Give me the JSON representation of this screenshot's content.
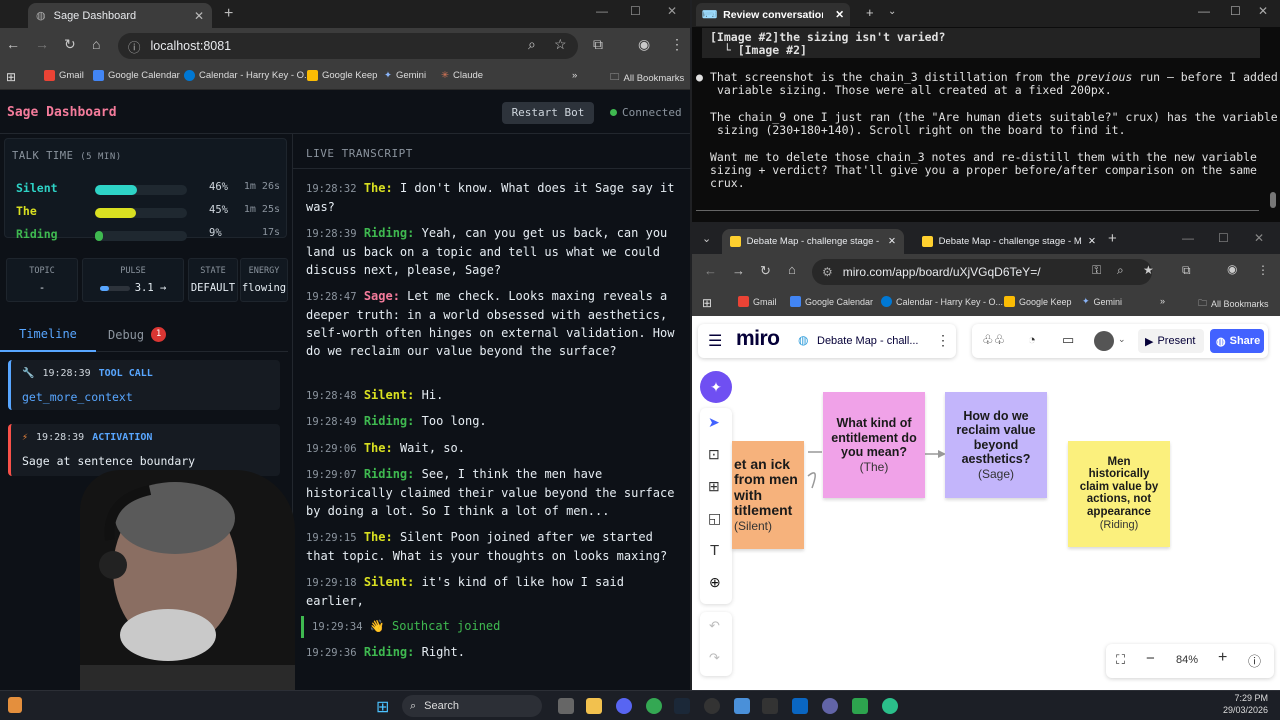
{
  "left_browser": {
    "tab_title": "Sage Dashboard",
    "url": "localhost:8081",
    "bookmarks": [
      "Gmail",
      "Google Calendar",
      "Calendar - Harry Key - O...",
      "Google Keep",
      "Gemini",
      "Claude"
    ],
    "all_bookmarks": "All Bookmarks"
  },
  "dashboard": {
    "title": "Sage Dashboard",
    "restart_label": "Restart Bot",
    "status": "Connected",
    "talk_time": {
      "heading": "TALK TIME",
      "window": "(5 MIN)",
      "rows": [
        {
          "name": "Silent",
          "pct": "46%",
          "fraction": 0.46,
          "time": "1m 26s",
          "color": "#2ed3c6"
        },
        {
          "name": "The",
          "pct": "45%",
          "fraction": 0.45,
          "time": "1m 25s",
          "color": "#d9e021"
        },
        {
          "name": "Riding",
          "pct": "9%",
          "fraction": 0.09,
          "time": "17s",
          "color": "#3fb950"
        }
      ]
    },
    "stats": {
      "topic_label": "TOPIC",
      "topic_value": "-",
      "pulse_label": "PULSE",
      "pulse_value": "3.1 →",
      "pulse_level": 0.31,
      "state_label": "STATE",
      "state_value": "DEFAULT",
      "energy_label": "ENERGY",
      "energy_value": "flowing"
    },
    "tabs": {
      "timeline": "Timeline",
      "debug": "Debug",
      "debug_count": "1"
    },
    "events": [
      {
        "time": "19:28:39",
        "type": "TOOL CALL",
        "text": "get_more_context",
        "color": "#58a6ff"
      },
      {
        "time": "19:28:39",
        "type": "ACTIVATION",
        "text": "Sage at sentence boundary",
        "color": "#f85149"
      }
    ],
    "transcript_heading": "LIVE TRANSCRIPT",
    "transcript": [
      {
        "time": "19:28:32",
        "speaker": "The:",
        "text": "I don't know. What does it Sage say it was?"
      },
      {
        "time": "19:28:39",
        "speaker": "Riding:",
        "text": "Yeah, can you get us back, can you land us back on a topic and tell us what we could discuss next, please, Sage?"
      },
      {
        "time": "19:28:47",
        "speaker": "Sage:",
        "text": "Let me check. Looks maxing reveals a deeper truth: in a world obsessed with aesthetics, self-worth often hinges on external validation. How do we reclaim our value beyond the surface?"
      },
      {
        "time": "19:28:48",
        "speaker": "Silent:",
        "text": "Hi."
      },
      {
        "time": "19:28:49",
        "speaker": "Riding:",
        "text": "Too long."
      },
      {
        "time": "19:29:06",
        "speaker": "The:",
        "text": "Wait, so."
      },
      {
        "time": "19:29:07",
        "speaker": "Riding:",
        "text": "See, I think the men have historically claimed their value beyond the surface by doing a lot. So I think a lot of men..."
      },
      {
        "time": "19:29:15",
        "speaker": "The:",
        "text": "Silent Poon joined after we started that topic. What is your thoughts on looks maxing?"
      },
      {
        "time": "19:29:18",
        "speaker": "Silent:",
        "text": "it's kind of like how I said earlier,"
      },
      {
        "time": "19:29:34",
        "speaker": "👋",
        "text": "Southcat joined"
      },
      {
        "time": "19:29:36",
        "speaker": "Riding:",
        "text": "Right."
      }
    ]
  },
  "terminal": {
    "tab_title": "Review conversation a",
    "line1": "[Image #2]the sizing isn't varied?",
    "line2": "  └ [Image #2]",
    "line3": "That screenshot is the chain_3 distillation from the ",
    "line3_em": "previous",
    "line3_end": " run — before I added",
    "line4": "variable sizing. Those were all created at a fixed 200px.",
    "line5": "The chain_9 one I just ran (the \"Are human diets suitable?\" crux) has the variable",
    "line6": "sizing (230+180+140). Scroll right on the board to find it.",
    "line7": "Want me to delete those chain_3 notes and re-distill them with the new variable",
    "line8": "sizing + verdict? That'll give you a proper before/after comparison on the same",
    "line9": "crux."
  },
  "miro_browser": {
    "tab1": "Debate Map - challenge stage - Miro",
    "tab2": "Debate Map - challenge stage - Miro",
    "url": "miro.com/app/board/uXjVGqD6TeY=/",
    "bookmarks": [
      "Gmail",
      "Google Calendar",
      "Calendar - Harry Key - O...",
      "Google Keep",
      "Gemini"
    ],
    "all_bookmarks": "All Bookmarks",
    "logo": "miro",
    "board_name": "Debate Map - chall...",
    "present": "Present",
    "share": "Share",
    "zoom": "84%",
    "notes": [
      {
        "text": "et an ick from men with titlement",
        "who": "(Silent)",
        "color": "#f6b27c"
      },
      {
        "text": "What kind of entitlement do you mean?",
        "who": "(The)",
        "color": "#f0a2e8"
      },
      {
        "text": "How do we reclaim value beyond aesthetics?",
        "who": "(Sage)",
        "color": "#c3b5fb"
      },
      {
        "text": "Men historically claim value by actions, not appearance",
        "who": "(Riding)",
        "color": "#fbf07d"
      }
    ]
  },
  "taskbar": {
    "search": "Search",
    "time": "7:29 PM",
    "date": "29/03/2026"
  }
}
